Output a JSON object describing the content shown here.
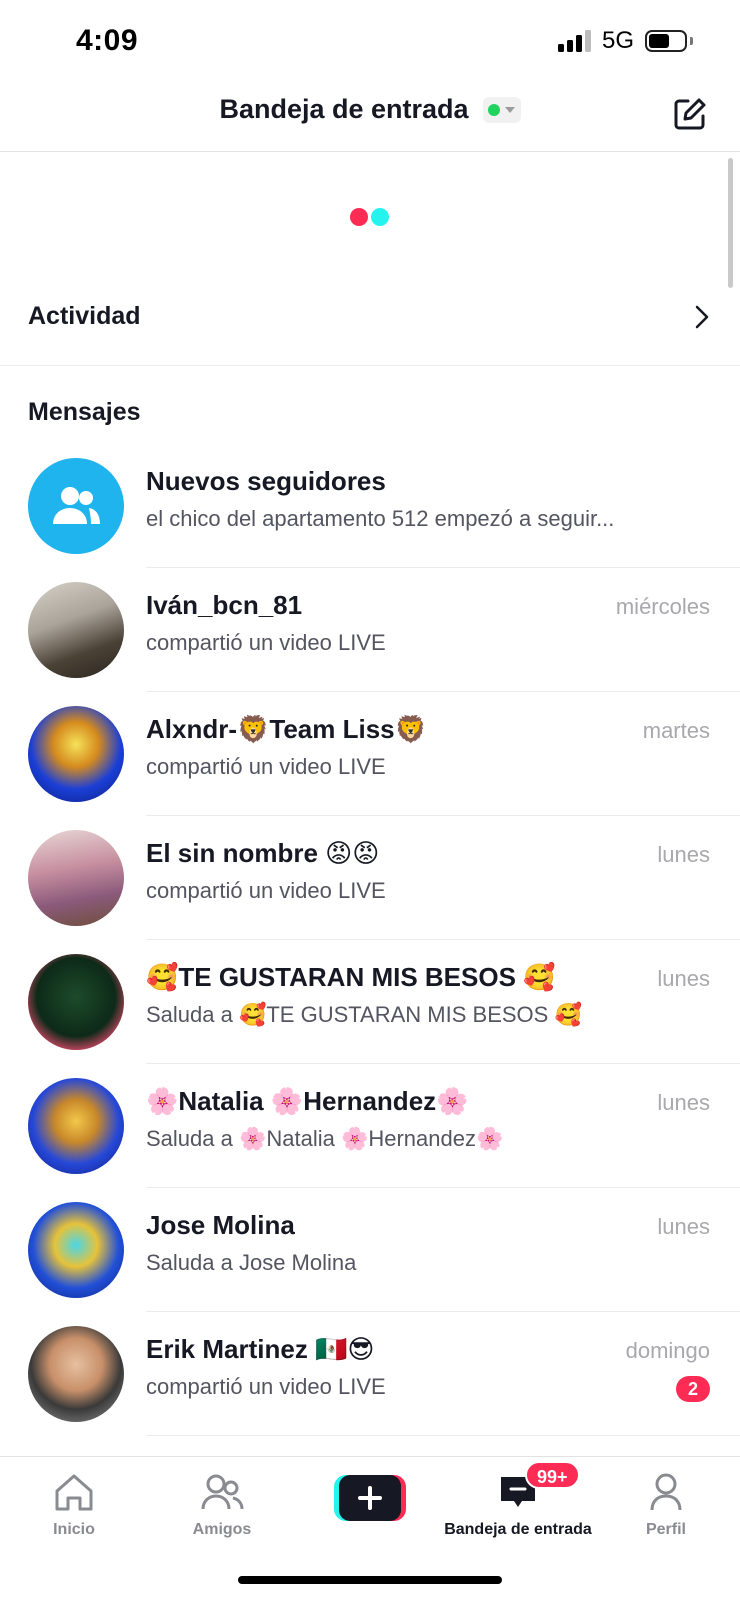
{
  "status_bar": {
    "time": "4:09",
    "network": "5G",
    "battery_level": 0.6
  },
  "header": {
    "title": "Bandeja de entrada",
    "online_status_color": "#20d35f"
  },
  "activity": {
    "label": "Actividad"
  },
  "messages_section": {
    "title": "Mensajes"
  },
  "messages": [
    {
      "name": "Nuevos seguidores",
      "subtitle": "el chico del apartamento 512 empezó a seguir...",
      "time": ""
    },
    {
      "name": "Iván_bcn_81",
      "subtitle": "compartió un video LIVE",
      "time": "miércoles"
    },
    {
      "name": "Alxndr-🦁Team Liss🦁",
      "subtitle": "compartió un video LIVE",
      "time": "martes"
    },
    {
      "name": "El sin nombre 😡😡",
      "subtitle": "compartió un video LIVE",
      "time": "lunes"
    },
    {
      "name": "🥰TE GUSTARAN MIS BESOS 🥰",
      "subtitle": "Saluda a 🥰TE GUSTARAN MIS BESOS 🥰",
      "time": "lunes"
    },
    {
      "name": "🌸Natalia 🌸Hernandez🌸",
      "subtitle": "Saluda a 🌸Natalia 🌸Hernandez🌸",
      "time": "lunes"
    },
    {
      "name": "Jose Molina",
      "subtitle": "Saluda a Jose Molina",
      "time": "lunes"
    },
    {
      "name": "Erik Martinez 🇲🇽😎",
      "subtitle": "compartió un video LIVE",
      "time": "domingo",
      "unread": "2"
    }
  ],
  "tab_bar": {
    "home": "Inicio",
    "friends": "Amigos",
    "inbox": "Bandeja de entrada",
    "inbox_badge": "99+",
    "profile": "Perfil"
  },
  "colors": {
    "accent_red": "#fe2c55",
    "accent_cyan": "#25f4ee",
    "followers_blue": "#20b4ee"
  },
  "icons": {
    "compose": "compose-icon",
    "chevron": "chevron-right-icon",
    "followers": "people-icon",
    "home": "home-icon",
    "friends": "friends-icon",
    "create": "plus-icon",
    "inbox": "inbox-icon",
    "profile": "profile-icon"
  }
}
